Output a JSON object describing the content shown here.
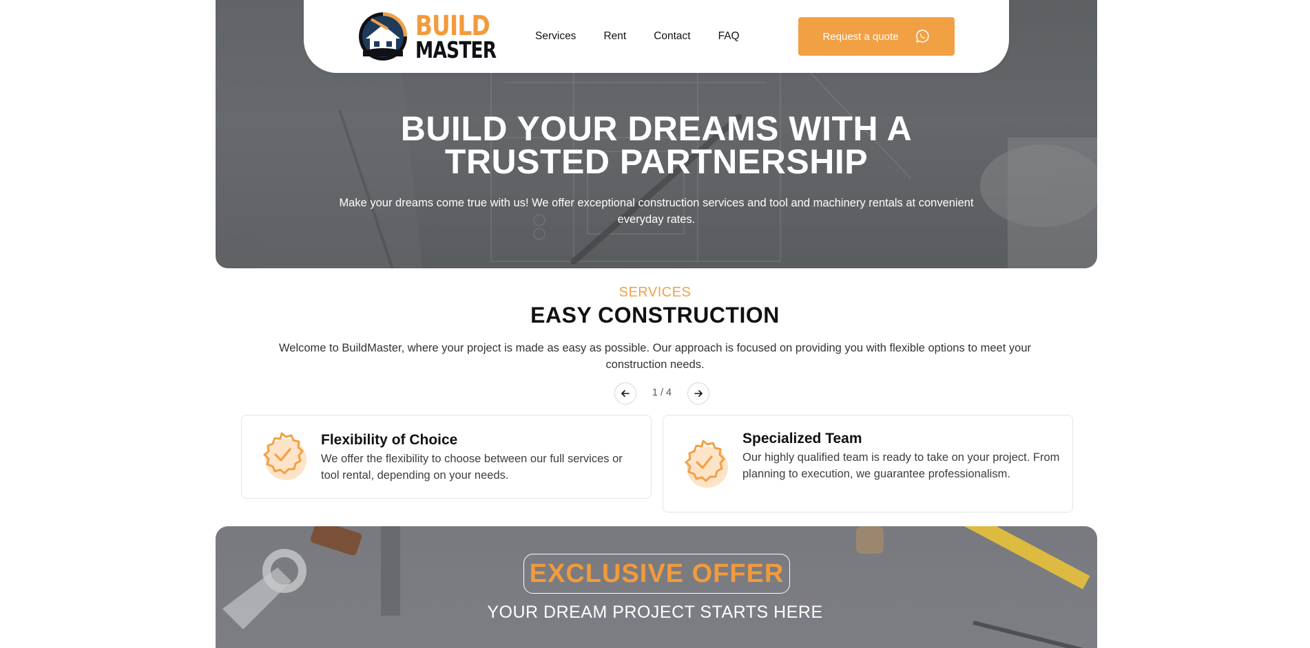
{
  "brand": {
    "word1": "BUILD",
    "word2": "MASTER",
    "accent": "#f2a044",
    "dark": "#0f1115"
  },
  "nav": {
    "links": [
      "Services",
      "Rent",
      "Contact",
      "FAQ"
    ],
    "quote_label": "Request a quote",
    "quote_icon": "whatsapp-icon"
  },
  "hero": {
    "title_line1": "BUILD YOUR DREAMS WITH A",
    "title_line2": "TRUSTED PARTNERSHIP",
    "subtitle": "Make your dreams come true with us! We offer exceptional construction services and tool and machinery rentals at convenient everyday rates."
  },
  "services": {
    "eyebrow": "SERVICES",
    "title": "EASY CONSTRUCTION",
    "description": "Welcome to BuildMaster, where your project is made as easy as possible. Our approach is focused on providing you with flexible options to meet your construction needs.",
    "pager": {
      "current": "1 / 4",
      "prev_icon": "arrow-left-icon",
      "next_icon": "arrow-right-icon"
    },
    "cards": [
      {
        "title": "Flexibility of Choice",
        "text": "We offer the flexibility to choose between our full services or tool rental, depending on your needs.",
        "icon": "check-badge-icon"
      },
      {
        "title": "Specialized Team",
        "text": "Our highly qualified team is ready to take on your project. From planning to execution, we guarantee professionalism.",
        "icon": "check-badge-icon"
      }
    ]
  },
  "offer": {
    "badge": "EXCLUSIVE OFFER",
    "subtitle": "YOUR DREAM PROJECT STARTS HERE"
  }
}
